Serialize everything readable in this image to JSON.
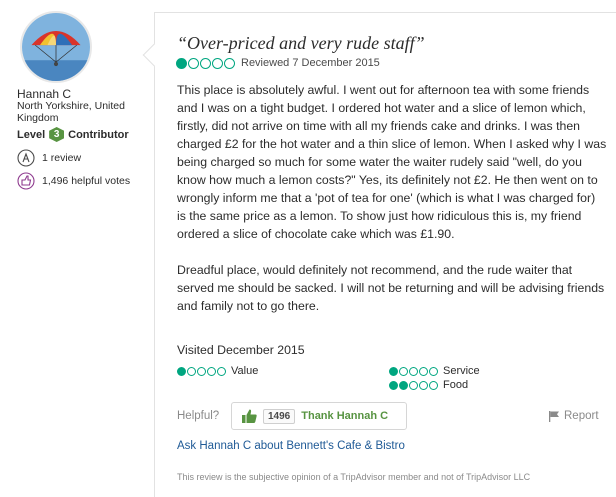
{
  "member": {
    "avatar": "avatar-parasailing-photo",
    "username": "Hannah C",
    "location": "North Yorkshire, United Kingdom",
    "level_prefix": "Level",
    "level_number": "3",
    "level_suffix": "Contributor",
    "reviews_icon": "pencil-badge-icon",
    "reviews": "1 review",
    "votes_icon": "thumb-badge-icon",
    "helpful_votes": "1,496 helpful votes"
  },
  "review": {
    "title": "“Over-priced and very rude staff”",
    "rating": 1,
    "rating_max": 5,
    "reviewed_date": "Reviewed 7 December 2015",
    "paragraphs": [
      "This place is absolutely awful. I went out for afternoon tea with some friends and I was on a tight budget. I ordered hot water and a slice of lemon which, firstly, did not arrive on time with all my friends cake and drinks. I was then charged £2 for the hot water and a thin slice of lemon. When I asked why I was being charged so much for some water the waiter rudely said \"well, do you know how much a lemon costs?\" Yes, its definitely not £2. He then went on to wrongly inform me that a 'pot of tea for one' (which is what I was charged for) is the same price as a lemon. To show just how ridiculous this is, my friend ordered a slice of chocolate cake which was £1.90.",
      "Dreadful place, would definitely not recommend, and the rude waiter that served me should be sacked. I will not be returning and will be advising friends and family not to go there."
    ],
    "visited": "Visited December 2015",
    "sub_ratings": {
      "value": {
        "label": "Value",
        "rating": 1
      },
      "service": {
        "label": "Service",
        "rating": 1
      },
      "food": {
        "label": "Food",
        "rating": 2
      }
    }
  },
  "actions": {
    "helpful_label": "Helpful?",
    "thank_icon": "thumbs-up-icon",
    "thank_count": "1496",
    "thank_label": "Thank Hannah C",
    "report_icon": "flag-icon",
    "report_label": "Report",
    "ask_link": "Ask Hannah C about Bennett's Cafe & Bistro"
  },
  "disclaimer": "This review is the subjective opinion of a TripAdvisor member and not of TripAdvisor LLC",
  "colors": {
    "rating_green": "#00a680",
    "level_green": "#589442",
    "link_blue": "#1f5a96",
    "muted_gray": "#8a8a8a"
  }
}
